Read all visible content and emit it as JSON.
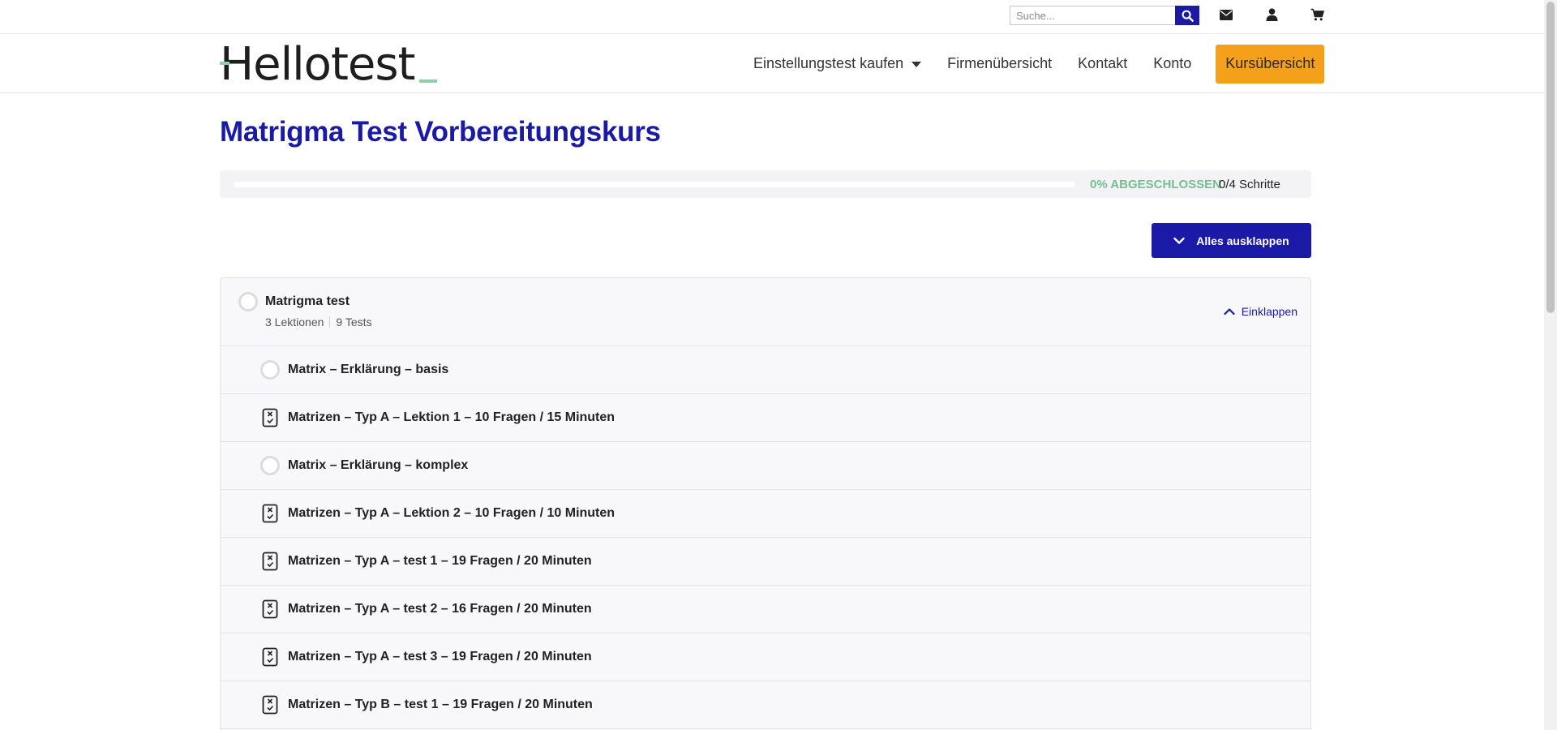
{
  "topbar": {
    "search_placeholder": "Suche...",
    "icons": [
      "search-icon",
      "mail-icon",
      "user-icon",
      "cart-icon"
    ]
  },
  "header": {
    "logo_text": "Hellotest",
    "nav": [
      {
        "label": "Einstellungstest kaufen",
        "has_dropdown": true
      },
      {
        "label": "Firmenübersicht"
      },
      {
        "label": "Kontakt"
      },
      {
        "label": "Konto"
      }
    ],
    "cta_label": "Kursübersicht"
  },
  "course": {
    "title": "Matrigma Test Vorbereitungskurs",
    "progress": {
      "percent": 0,
      "label": "0% ABGESCHLOSSEN",
      "steps": "0/4 Schritte"
    },
    "expand_all_label": "Alles ausklappen",
    "section": {
      "title": "Matrigma test",
      "lessons": "3 Lektionen",
      "tests": "9 Tests",
      "collapse_label": "Einklappen",
      "items": [
        {
          "type": "lesson",
          "label": "Matrix – Erklärung – basis"
        },
        {
          "type": "quiz",
          "label": "Matrizen – Typ A – Lektion 1 – 10 Fragen / 15 Minuten"
        },
        {
          "type": "lesson",
          "label": "Matrix – Erklärung – komplex"
        },
        {
          "type": "quiz",
          "label": "Matrizen – Typ A – Lektion 2 – 10 Fragen / 10 Minuten"
        },
        {
          "type": "quiz",
          "label": "Matrizen – Typ A – test 1 – 19 Fragen / 20 Minuten"
        },
        {
          "type": "quiz",
          "label": "Matrizen – Typ A – test 2 – 16 Fragen / 20 Minuten"
        },
        {
          "type": "quiz",
          "label": "Matrizen – Typ A – test 3 – 19 Fragen / 20 Minuten"
        },
        {
          "type": "quiz",
          "label": "Matrizen – Typ B – test 1 – 19 Fragen / 20 Minuten"
        }
      ]
    }
  },
  "colors": {
    "brand_blue": "#1a1aa6",
    "accent_orange": "#f5a01a",
    "progress_green": "#72c08f"
  }
}
